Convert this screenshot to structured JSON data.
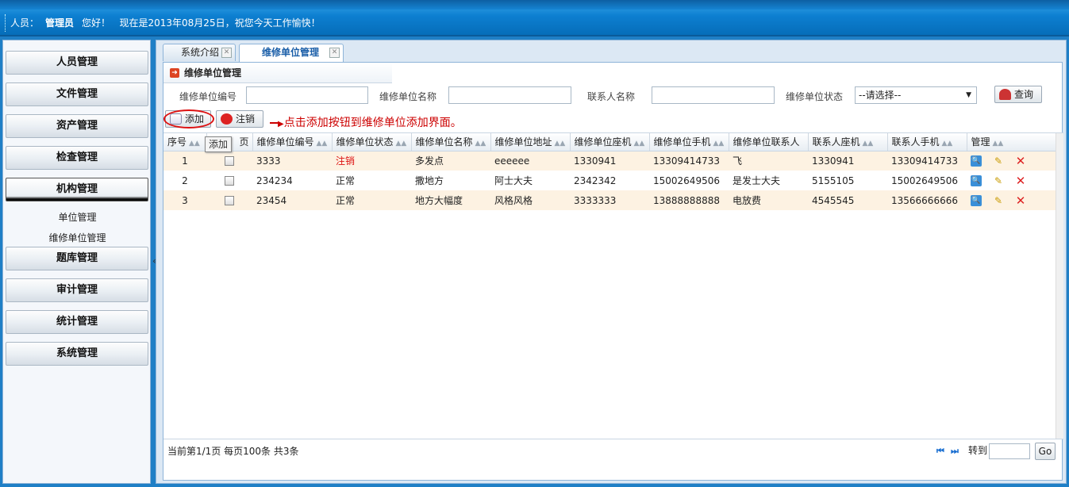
{
  "header": {
    "user_label": "人员：",
    "user_name": "管理员",
    "greeting": "您好！",
    "date_msg": "现在是2013年08月25日，祝您今天工作愉快！"
  },
  "sidebar": {
    "menus": [
      {
        "label": "人员管理"
      },
      {
        "label": "文件管理"
      },
      {
        "label": "资产管理"
      },
      {
        "label": "检查管理"
      },
      {
        "label": "机构管理"
      },
      {
        "label": "题库管理"
      },
      {
        "label": "审计管理"
      },
      {
        "label": "统计管理"
      },
      {
        "label": "系统管理"
      }
    ],
    "sub_items": [
      "单位管理",
      "维修单位管理"
    ],
    "collapse": "«"
  },
  "tabs": [
    {
      "label": "系统介绍"
    },
    {
      "label": "维修单位管理"
    }
  ],
  "panel": {
    "title": "维修单位管理",
    "search": {
      "code_label": "维修单位编号",
      "name_label": "维修单位名称",
      "contact_label": "联系人名称",
      "status_label": "维修单位状态",
      "status_value": "--请选择--",
      "query_button": "查询"
    },
    "toolbar": {
      "add": "添加",
      "cancel": "注销",
      "annotation": "点击添加按钮到维修单位添加界面。",
      "tooltip": "添加"
    }
  },
  "grid": {
    "columns": [
      "序号",
      "页",
      "维修单位编号",
      "维修单位状态",
      "维修单位名称",
      "维修单位地址",
      "维修单位座机",
      "维修单位手机",
      "维修单位联系人",
      "联系人座机",
      "联系人手机",
      "管理"
    ],
    "rows": [
      {
        "no": "1",
        "code": "3333",
        "status": "注销",
        "name": "多发点",
        "addr": "eeeeee",
        "tel": "1330941",
        "mobile": "13309414733",
        "contact": "飞",
        "ctel": "1330941",
        "cmobile": "13309414733"
      },
      {
        "no": "2",
        "code": "234234",
        "status": "正常",
        "name": "撒地方",
        "addr": "阿士大夫",
        "tel": "2342342",
        "mobile": "15002649506",
        "contact": "是发士大夫",
        "ctel": "5155105",
        "cmobile": "15002649506"
      },
      {
        "no": "3",
        "code": "23454",
        "status": "正常",
        "name": "地方大幅度",
        "addr": "风格风格",
        "tel": "3333333",
        "mobile": "13888888888",
        "contact": "电放费",
        "ctel": "4545545",
        "cmobile": "13566666666"
      }
    ]
  },
  "footer": {
    "summary": "当前第1/1页  每页100条  共3条",
    "goto_label": "转到",
    "go_button": "Go"
  },
  "colors": {
    "accent": "#1a5ea8",
    "annotation": "#cc0000",
    "odd_row": "#fdf2e2"
  }
}
